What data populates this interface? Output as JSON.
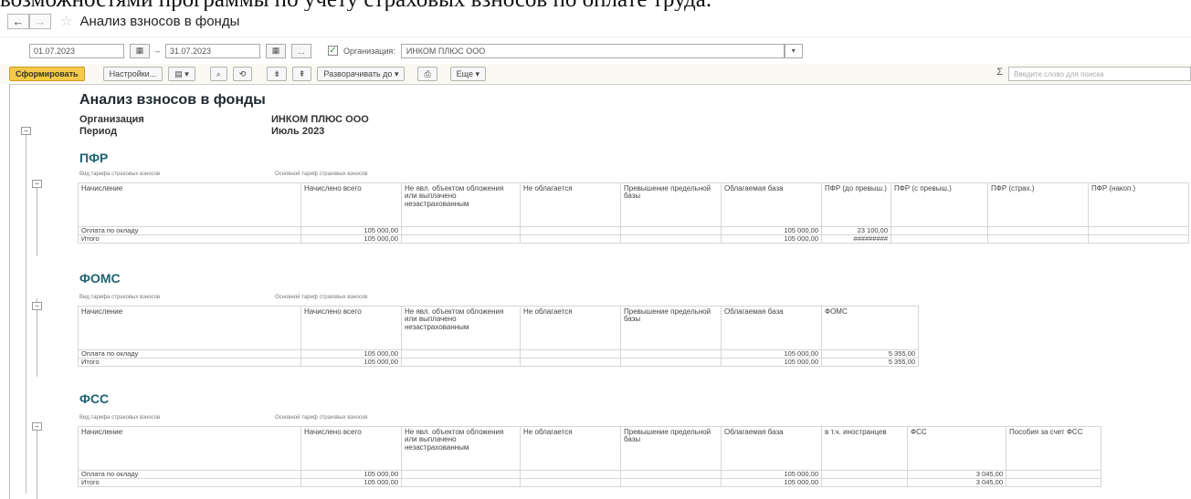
{
  "cut_text": "возможностями программы по учету страховых взносов по оплате труда.",
  "window": {
    "title": "Анализ взносов в фонды",
    "back_icon": "arrow-left-icon",
    "forward_icon": "arrow-right-icon",
    "favorite_icon": "star-icon"
  },
  "params": {
    "date_from": "01.07.2023",
    "dash": "–",
    "date_to": "31.07.2023",
    "period_button": "...",
    "org_label": "Организация:",
    "org_value": "ИНКОМ ПЛЮС ООО"
  },
  "toolbar": {
    "generate": "Сформировать",
    "settings": "Настройки...",
    "expand": "Разворачивать до",
    "more": "Еще",
    "search_placeholder": "Введите слово для поиска"
  },
  "report": {
    "title": "Анализ взносов в фонды",
    "org_label": "Организация",
    "org_value": "ИНКОМ ПЛЮС ООО",
    "period_label": "Период",
    "period_value": "Июль 2023",
    "tariff_label": "Вид тарифа страховых взносов",
    "tariff_value": "Основной тариф страховых взносов",
    "common_headers": [
      "Начисление",
      "Начислено всего",
      "Не явл. объектом обложения или выплачено незастрахованным",
      "Не облагается",
      "Превышение предельной базы",
      "Облагаемая база"
    ],
    "rows": {
      "pay": "Оплата по окладу",
      "total": "Итого"
    },
    "pfr": {
      "title": "ПФР",
      "extra_headers": [
        "ПФР (до превыш.)",
        "ПФР (с превыш.)",
        "ПФР (страх.)",
        "ПФР (накоп.)"
      ],
      "pay": {
        "accrued": "105 000,00",
        "base": "105 000,00",
        "pfr_before": "23 100,00"
      },
      "total": {
        "accrued": "105 000,00",
        "base": "105 000,00",
        "pfr_before": "#########"
      }
    },
    "foms": {
      "title": "ФОМС",
      "extra_headers": [
        "ФОМС"
      ],
      "pay": {
        "accrued": "105 000,00",
        "base": "105 000,00",
        "foms": "5 355,00"
      },
      "total": {
        "accrued": "105 000,00",
        "base": "105 000,00",
        "foms": "5 355,00"
      }
    },
    "fss": {
      "title": "ФСС",
      "extra_headers": [
        "в т.ч. иностранцев",
        "ФСС",
        "Пособия за счет ФСС"
      ],
      "pay": {
        "accrued": "105 000,00",
        "base": "105 000,00",
        "fss": "3 045,00"
      },
      "total": {
        "accrued": "105 000,00",
        "base": "105 000,00",
        "fss": "3 045,00"
      }
    }
  }
}
